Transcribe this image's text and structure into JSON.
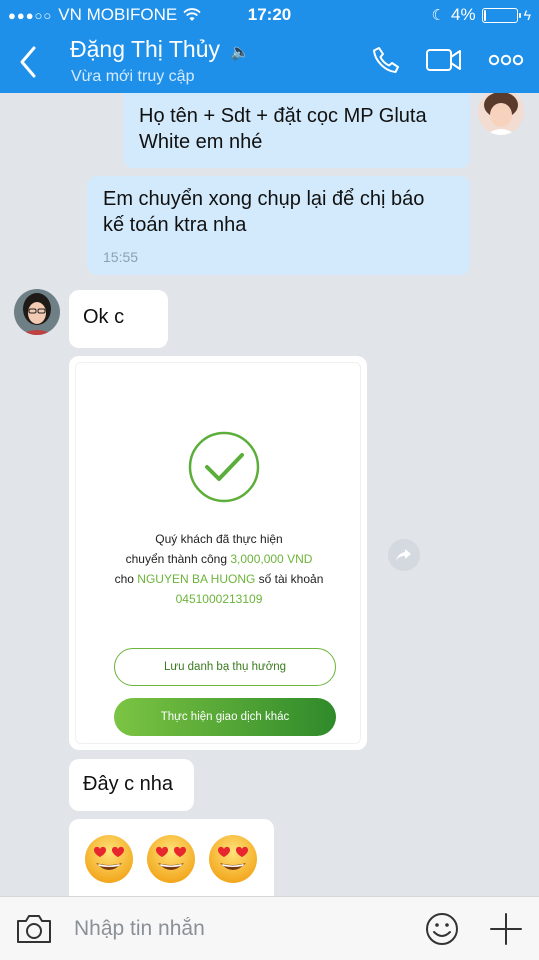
{
  "status_bar": {
    "carrier": "VN MOBIFONE",
    "time": "17:20",
    "battery": "4%",
    "battery_level": 0.04
  },
  "header": {
    "contact_name": "Đặng Thị Thủy",
    "status": "Vừa mới truy cập",
    "accent": "#1e90ea",
    "icons": [
      "back-icon",
      "phone-icon",
      "video-icon",
      "more-icon"
    ]
  },
  "messages": [
    {
      "from": "me",
      "text_line1": "Họ tên + Sdt + đặt cọc MP Gluta",
      "text_line2": "White em nhé"
    },
    {
      "from": "me",
      "text_line1": "Em chuyển xong chụp lại để chị báo",
      "text_line2": "kế toán ktra nha",
      "time": "15:55"
    },
    {
      "from": "them",
      "text": "Ok c"
    },
    {
      "from": "them",
      "type": "image-receipt"
    },
    {
      "from": "them",
      "text": "Đây c nha"
    },
    {
      "from": "them",
      "type": "emoji",
      "emoji": [
        "heart-eyes",
        "heart-eyes",
        "heart-eyes"
      ]
    }
  ],
  "receipt": {
    "line1": "Quý khách đã thực hiện",
    "line2_prefix": "chuyển thành công ",
    "amount": "3,000,000 VND",
    "line3_prefix": "cho ",
    "recipient": "NGUYEN BA HUONG",
    "line3_suffix": " số tài khoản",
    "account": "0451000213109",
    "btn_save": "Lưu danh bạ thụ hưởng",
    "btn_new": "Thực hiện giao dịch khác",
    "accent": "#6db43c"
  },
  "input": {
    "placeholder": "Nhập tin nhắn"
  }
}
